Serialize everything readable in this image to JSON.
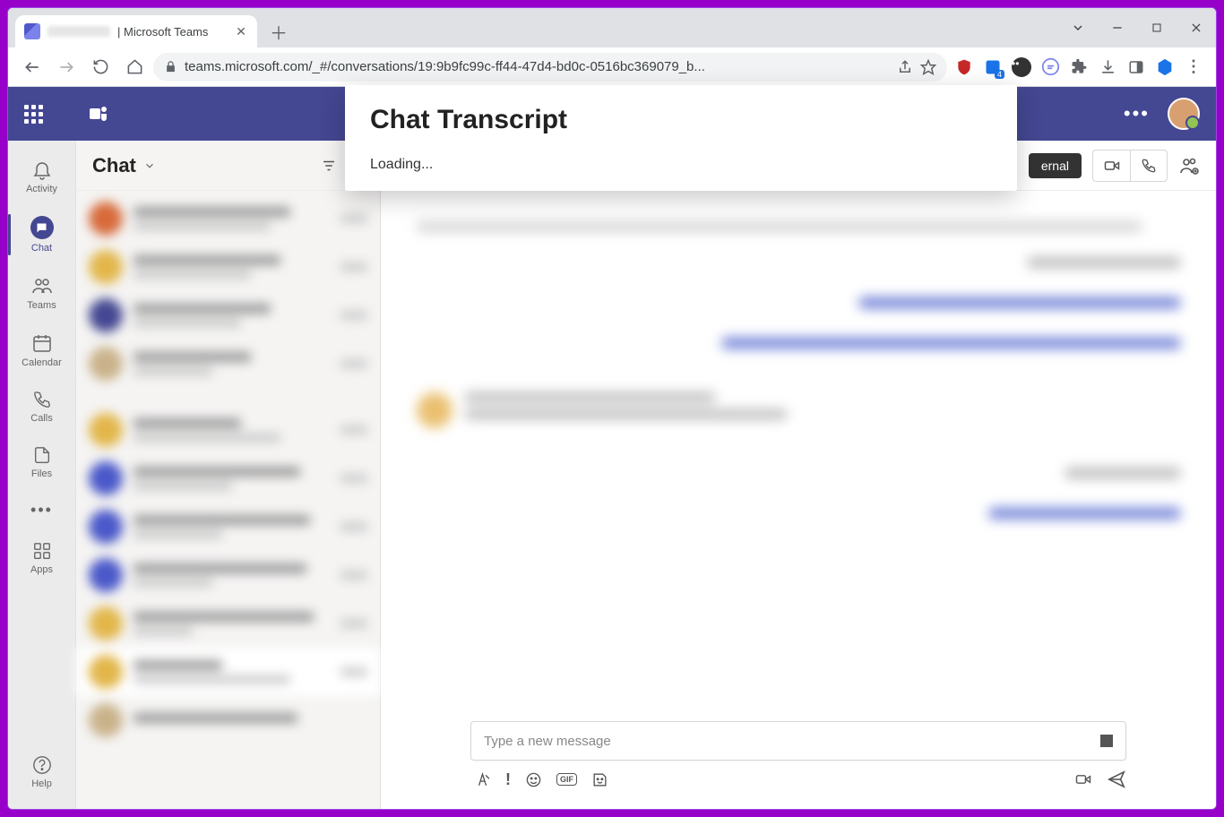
{
  "browser": {
    "tab_title": "| Microsoft Teams",
    "url": "teams.microsoft.com/_#/conversations/19:9b9fc99c-ff44-47d4-bd0c-0516bc369079_b...",
    "ext_badge": "4"
  },
  "rail": {
    "activity": "Activity",
    "chat": "Chat",
    "teams": "Teams",
    "calendar": "Calendar",
    "calls": "Calls",
    "files": "Files",
    "apps": "Apps",
    "help": "Help"
  },
  "chatlist": {
    "title": "Chat"
  },
  "conv": {
    "external_badge": "ernal",
    "composer_placeholder": "Type a new message"
  },
  "popup": {
    "title": "Chat Transcript",
    "status": "Loading..."
  }
}
